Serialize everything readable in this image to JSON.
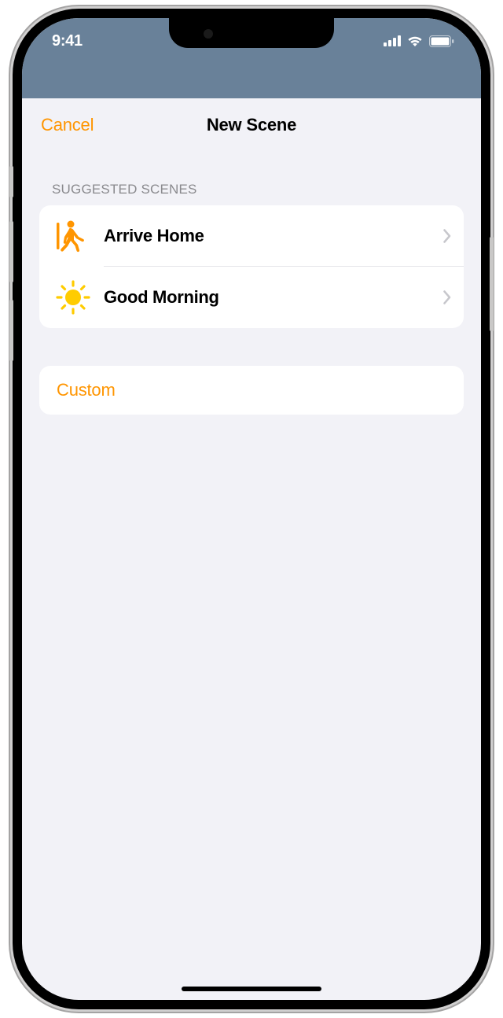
{
  "statusBar": {
    "time": "9:41"
  },
  "nav": {
    "cancel": "Cancel",
    "title": "New Scene"
  },
  "section": {
    "header": "SUGGESTED SCENES"
  },
  "scenes": {
    "arriveHome": {
      "label": "Arrive Home"
    },
    "goodMorning": {
      "label": "Good Morning"
    }
  },
  "custom": {
    "label": "Custom"
  }
}
